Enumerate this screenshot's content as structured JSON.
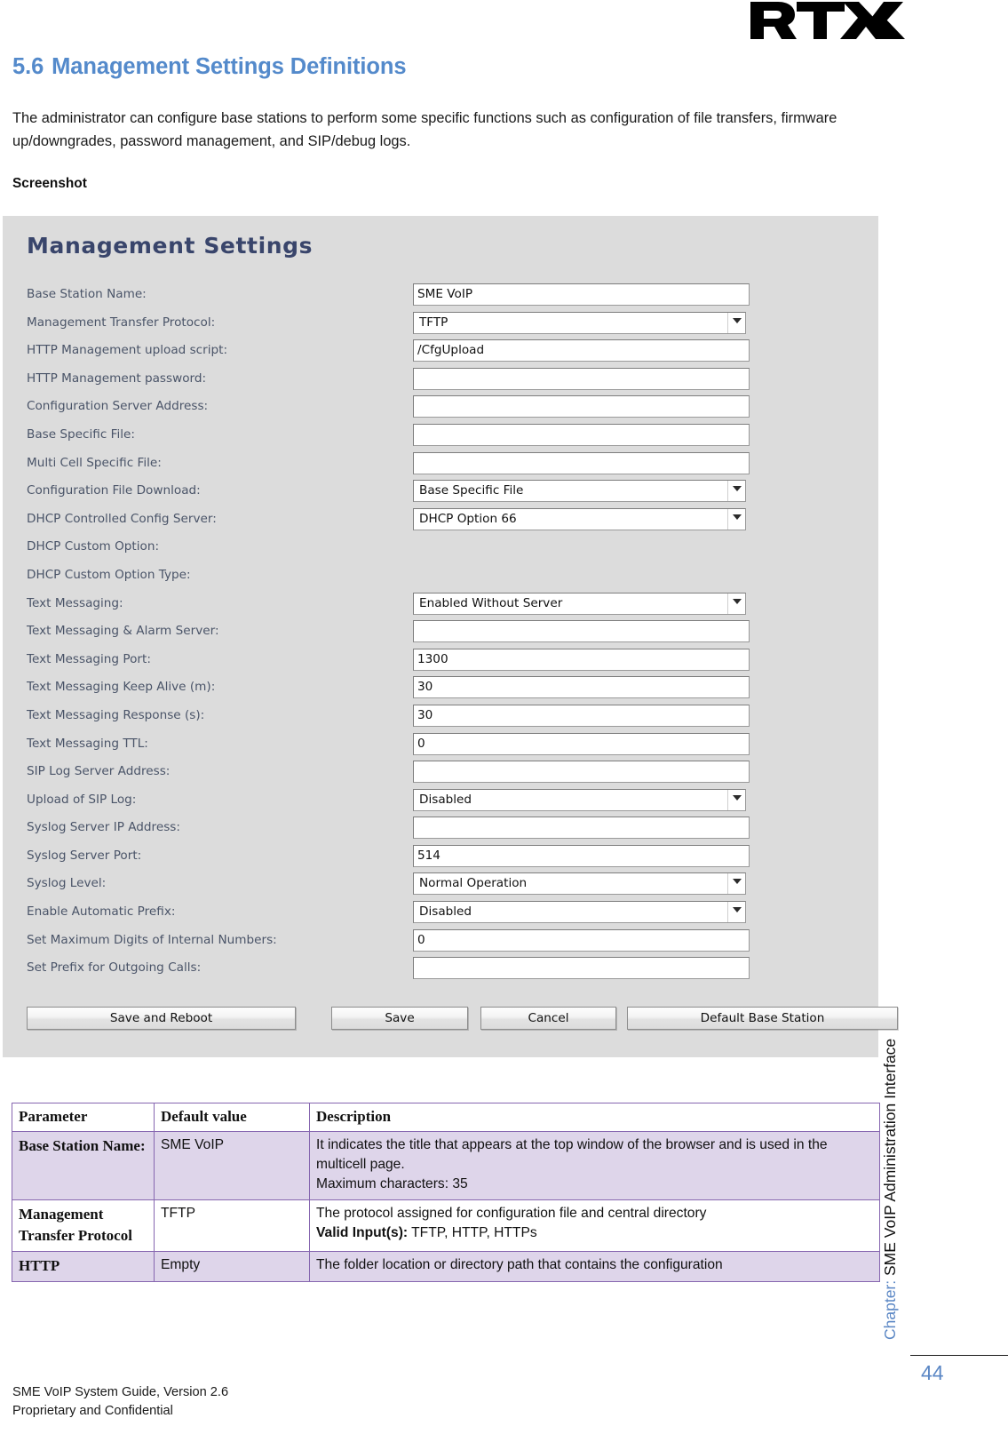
{
  "logo": {
    "name": "RTX",
    "alt": "RTX logo"
  },
  "document": {
    "section_number": "5.6",
    "section_title": "Management Settings Definitions",
    "intro": "The administrator can configure base stations to perform some specific functions such as configuration of file transfers, firmware up/downgrades, password management, and SIP/debug logs.",
    "screenshot_label": "Screenshot"
  },
  "screenshot": {
    "title": "Management Settings",
    "fields": [
      {
        "label": "Base Station Name:",
        "type": "text",
        "value": "SME VoIP"
      },
      {
        "label": "Management Transfer Protocol:",
        "type": "select",
        "value": "TFTP"
      },
      {
        "label": "HTTP Management upload script:",
        "type": "text",
        "value": "/CfgUpload"
      },
      {
        "label": "HTTP Management password:",
        "type": "text",
        "value": ""
      },
      {
        "label": "Configuration Server Address:",
        "type": "text",
        "value": ""
      },
      {
        "label": "Base Specific File:",
        "type": "text",
        "value": ""
      },
      {
        "label": "Multi Cell Specific File:",
        "type": "text",
        "value": ""
      },
      {
        "label": "Configuration File Download:",
        "type": "select",
        "value": "Base Specific File"
      },
      {
        "label": "DHCP Controlled Config Server:",
        "type": "select",
        "value": "DHCP Option 66"
      },
      {
        "label": "DHCP Custom Option:",
        "type": "none",
        "value": ""
      },
      {
        "label": "DHCP Custom Option Type:",
        "type": "none",
        "value": ""
      },
      {
        "label": "Text Messaging:",
        "type": "select",
        "value": "Enabled Without Server"
      },
      {
        "label": "Text Messaging & Alarm Server:",
        "type": "text",
        "value": ""
      },
      {
        "label": "Text Messaging Port:",
        "type": "text",
        "value": "1300"
      },
      {
        "label": "Text Messaging Keep Alive (m):",
        "type": "text",
        "value": "30"
      },
      {
        "label": "Text Messaging Response (s):",
        "type": "text",
        "value": "30"
      },
      {
        "label": "Text Messaging TTL:",
        "type": "text",
        "value": "0"
      },
      {
        "label": "SIP Log Server Address:",
        "type": "text",
        "value": ""
      },
      {
        "label": "Upload of SIP Log:",
        "type": "select",
        "value": "Disabled"
      },
      {
        "label": "Syslog Server IP Address:",
        "type": "text",
        "value": ""
      },
      {
        "label": "Syslog Server Port:",
        "type": "text",
        "value": "514"
      },
      {
        "label": "Syslog Level:",
        "type": "select",
        "value": "Normal Operation"
      },
      {
        "label": "Enable Automatic Prefix:",
        "type": "select",
        "value": "Disabled"
      },
      {
        "label": "Set Maximum Digits of Internal Numbers:",
        "type": "text",
        "value": "0"
      },
      {
        "label": "Set Prefix for Outgoing Calls:",
        "type": "text",
        "value": ""
      }
    ],
    "buttons": {
      "save_and_reboot": "Save and Reboot",
      "save": "Save",
      "cancel": "Cancel",
      "default_base_station": "Default Base Station"
    }
  },
  "table": {
    "headers": [
      "Parameter",
      "Default value",
      "Description"
    ],
    "rows": [
      {
        "parameter": "Base Station Name:",
        "default": "SME VoIP",
        "desc_lines": [
          "It indicates the title that appears at the top window of the browser and is used in the multicell page.",
          "Maximum characters: 35"
        ],
        "valid_label": "",
        "valid_values": "",
        "shaded": true
      },
      {
        "parameter": "Management Transfer Protocol",
        "default": "TFTP",
        "desc_lines": [
          "The protocol assigned for configuration file and central directory"
        ],
        "valid_label": "Valid Input(s):",
        "valid_values": " TFTP, HTTP, HTTPs",
        "shaded": false
      },
      {
        "parameter": "HTTP",
        "default": "Empty",
        "desc_lines": [
          "The folder location or directory path that contains the configuration"
        ],
        "valid_label": "",
        "valid_values": "",
        "shaded": true
      }
    ]
  },
  "rail": {
    "chapter_prefix": "Chapter:",
    "chapter_text": " SME VoIP Administration Interface",
    "page_number": "44"
  },
  "footer": {
    "line1": "SME VoIP System Guide, Version 2.6",
    "line2": "Proprietary and Confidential"
  },
  "colors": {
    "heading_blue": "#548ACB",
    "panel_grey": "#dcdcdc",
    "panel_title_navy": "#39456b",
    "table_border_purple": "#8666B0",
    "table_shade": "#DED5EA"
  }
}
